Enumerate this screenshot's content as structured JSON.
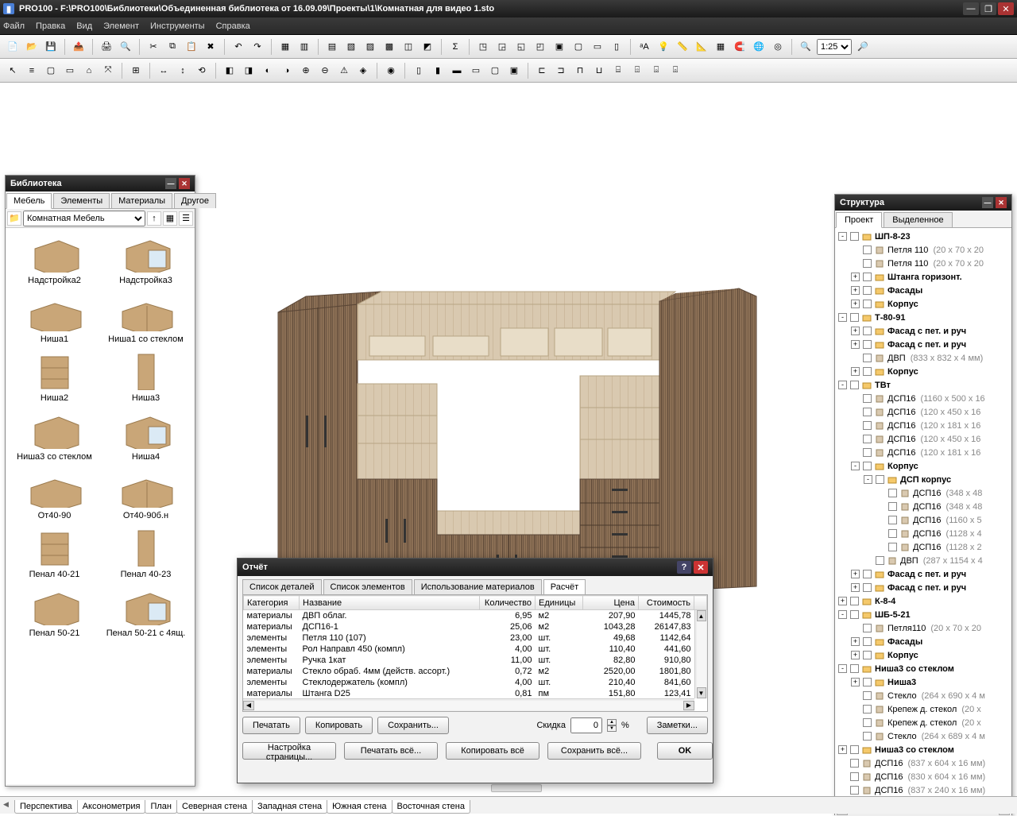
{
  "title": "PRO100 - F:\\PRO100\\Библиотеки\\Объединенная библиотека от 16.09.09\\Проекты\\1\\Комнатная для видео 1.sto",
  "menu": [
    "Файл",
    "Правка",
    "Вид",
    "Элемент",
    "Инструменты",
    "Справка"
  ],
  "zoom": "1:25",
  "library": {
    "title": "Библиотека",
    "tabs": [
      "Мебель",
      "Элементы",
      "Материалы",
      "Другое"
    ],
    "active_tab": 0,
    "category": "Комнатная Мебель",
    "items": [
      {
        "label": "Надстройка2"
      },
      {
        "label": "Надстройка3"
      },
      {
        "label": "Ниша1"
      },
      {
        "label": "Ниша1 со стеклом"
      },
      {
        "label": "Ниша2"
      },
      {
        "label": "Ниша3"
      },
      {
        "label": "Ниша3 со стеклом"
      },
      {
        "label": "Ниша4"
      },
      {
        "label": "От40-90"
      },
      {
        "label": "От40-90б.н"
      },
      {
        "label": "Пенал 40-21"
      },
      {
        "label": "Пенал 40-23"
      },
      {
        "label": "Пенал 50-21"
      },
      {
        "label": "Пенал 50-21 с 4ящ."
      }
    ]
  },
  "structure": {
    "title": "Структура",
    "tabs": [
      "Проект",
      "Выделенное"
    ],
    "active_tab": 0,
    "nodes": [
      {
        "d": 1,
        "exp": "-",
        "bold": true,
        "ico": "g",
        "name": "ШП-8-23"
      },
      {
        "d": 2,
        "exp": "",
        "ico": "p",
        "name": "Петля 110",
        "dim": "(20 x 70 x 20"
      },
      {
        "d": 2,
        "exp": "",
        "ico": "p",
        "name": "Петля 110",
        "dim": "(20 x 70 x 20"
      },
      {
        "d": 2,
        "exp": "+",
        "bold": true,
        "ico": "g",
        "name": "Штанга горизонт."
      },
      {
        "d": 2,
        "exp": "+",
        "bold": true,
        "ico": "g",
        "name": "Фасады"
      },
      {
        "d": 2,
        "exp": "+",
        "bold": true,
        "ico": "g",
        "name": "Корпус"
      },
      {
        "d": 1,
        "exp": "-",
        "bold": true,
        "ico": "g",
        "name": "Т-80-91"
      },
      {
        "d": 2,
        "exp": "+",
        "bold": true,
        "ico": "g",
        "name": "Фасад с пет. и руч"
      },
      {
        "d": 2,
        "exp": "+",
        "bold": true,
        "ico": "g",
        "name": "Фасад с пет. и руч"
      },
      {
        "d": 2,
        "exp": "",
        "ico": "p",
        "name": "ДВП",
        "dim": "(833 x 832 x 4 мм)"
      },
      {
        "d": 2,
        "exp": "+",
        "bold": true,
        "ico": "g",
        "name": "Корпус"
      },
      {
        "d": 1,
        "exp": "-",
        "bold": true,
        "ico": "g",
        "name": "ТВт"
      },
      {
        "d": 2,
        "exp": "",
        "ico": "p",
        "name": "ДСП16",
        "dim": "(1160 x 500 x 16"
      },
      {
        "d": 2,
        "exp": "",
        "ico": "p",
        "name": "ДСП16",
        "dim": "(120 x 450 x 16"
      },
      {
        "d": 2,
        "exp": "",
        "ico": "p",
        "name": "ДСП16",
        "dim": "(120 x 181 x 16"
      },
      {
        "d": 2,
        "exp": "",
        "ico": "p",
        "name": "ДСП16",
        "dim": "(120 x 450 x 16"
      },
      {
        "d": 2,
        "exp": "",
        "ico": "p",
        "name": "ДСП16",
        "dim": "(120 x 181 x 16"
      },
      {
        "d": 2,
        "exp": "-",
        "bold": true,
        "ico": "g",
        "name": "Корпус"
      },
      {
        "d": 3,
        "exp": "-",
        "bold": true,
        "ico": "g",
        "name": "ДСП корпус"
      },
      {
        "d": 4,
        "exp": "",
        "ico": "p",
        "name": "ДСП16",
        "dim": "(348 x 48"
      },
      {
        "d": 4,
        "exp": "",
        "ico": "p",
        "name": "ДСП16",
        "dim": "(348 x 48"
      },
      {
        "d": 4,
        "exp": "",
        "ico": "p",
        "name": "ДСП16",
        "dim": "(1160 x 5"
      },
      {
        "d": 4,
        "exp": "",
        "ico": "p",
        "name": "ДСП16",
        "dim": "(1128 x 4"
      },
      {
        "d": 4,
        "exp": "",
        "ico": "p",
        "name": "ДСП16",
        "dim": "(1128 x 2"
      },
      {
        "d": 3,
        "exp": "",
        "ico": "p",
        "name": "ДВП",
        "dim": "(287 x 1154 x 4"
      },
      {
        "d": 2,
        "exp": "+",
        "bold": true,
        "ico": "g",
        "name": "Фасад с пет. и руч"
      },
      {
        "d": 2,
        "exp": "+",
        "bold": true,
        "ico": "g",
        "name": "Фасад с пет. и руч"
      },
      {
        "d": 1,
        "exp": "+",
        "bold": true,
        "ico": "g",
        "name": "К-8-4"
      },
      {
        "d": 1,
        "exp": "-",
        "bold": true,
        "ico": "g",
        "name": "ШБ-5-21"
      },
      {
        "d": 2,
        "exp": "",
        "ico": "p",
        "name": "Петля110",
        "dim": "(20 x 70 x 20"
      },
      {
        "d": 2,
        "exp": "+",
        "bold": true,
        "ico": "g",
        "name": "Фасады"
      },
      {
        "d": 2,
        "exp": "+",
        "bold": true,
        "ico": "g",
        "name": "Корпус"
      },
      {
        "d": 1,
        "exp": "-",
        "bold": true,
        "ico": "g",
        "name": "Ниша3 со стеклом"
      },
      {
        "d": 2,
        "exp": "+",
        "bold": true,
        "ico": "g",
        "name": "Ниша3"
      },
      {
        "d": 2,
        "exp": "",
        "ico": "p",
        "name": "Стекло",
        "dim": "(264 x 690 x 4 м"
      },
      {
        "d": 2,
        "exp": "",
        "ico": "p",
        "name": "Крепеж д. стекол",
        "dim": "(20 x"
      },
      {
        "d": 2,
        "exp": "",
        "ico": "p",
        "name": "Крепеж д. стекол",
        "dim": "(20 x"
      },
      {
        "d": 2,
        "exp": "",
        "ico": "p",
        "name": "Стекло",
        "dim": "(264 x 689 x 4 м"
      },
      {
        "d": 1,
        "exp": "+",
        "bold": true,
        "ico": "g",
        "name": "Ниша3 со стеклом"
      },
      {
        "d": 1,
        "exp": "",
        "ico": "p",
        "name": "ДСП16",
        "dim": "(837 x 604 x 16 мм)"
      },
      {
        "d": 1,
        "exp": "",
        "ico": "p",
        "name": "ДСП16",
        "dim": "(830 x 604 x 16 мм)"
      },
      {
        "d": 1,
        "exp": "",
        "ico": "p",
        "name": "ДСП16",
        "dim": "(837 x 240 x 16 мм)"
      }
    ]
  },
  "report": {
    "title": "Отчёт",
    "tabs": [
      "Список деталей",
      "Список элементов",
      "Использование материалов",
      "Расчёт"
    ],
    "active_tab": 3,
    "columns": [
      "Категория",
      "Название",
      "Количество",
      "Единицы",
      "Цена",
      "Стоимость"
    ],
    "rows": [
      [
        "материалы",
        "ДВП облаг.",
        "6,95",
        "м2",
        "207,90",
        "1445,78"
      ],
      [
        "материалы",
        "ДСП16-1",
        "25,06",
        "м2",
        "1043,28",
        "26147,83"
      ],
      [
        "элементы",
        "Петля 110 (107)",
        "23,00",
        "шт.",
        "49,68",
        "1142,64"
      ],
      [
        "элементы",
        "Рол Направл 450 (компл)",
        "4,00",
        "шт.",
        "110,40",
        "441,60"
      ],
      [
        "элементы",
        "Ручка 1кат",
        "11,00",
        "шт.",
        "82,80",
        "910,80"
      ],
      [
        "материалы",
        "Стекло обраб. 4мм (действ. ассорт.)",
        "0,72",
        "м2",
        "2520,00",
        "1801,80"
      ],
      [
        "элементы",
        "Стеклодержатель (компл)",
        "4,00",
        "шт.",
        "210,40",
        "841,60"
      ],
      [
        "материалы",
        "Штанга D25",
        "0,81",
        "пм",
        "151,80",
        "123,41"
      ]
    ],
    "btn_print": "Печатать",
    "btn_copy": "Копировать",
    "btn_save": "Сохранить...",
    "lbl_discount": "Скидка",
    "discount_value": "0",
    "discount_unit": "%",
    "btn_notes": "Заметки...",
    "btn_pagesetup": "Настройка страницы...",
    "btn_printall": "Печатать всё...",
    "btn_copyall": "Копировать всё",
    "btn_saveall": "Сохранить всё...",
    "btn_ok": "OK"
  },
  "viewtabs": [
    "Перспектива",
    "Аксонометрия",
    "План",
    "Северная стена",
    "Западная стена",
    "Южная стена",
    "Восточная стена"
  ]
}
